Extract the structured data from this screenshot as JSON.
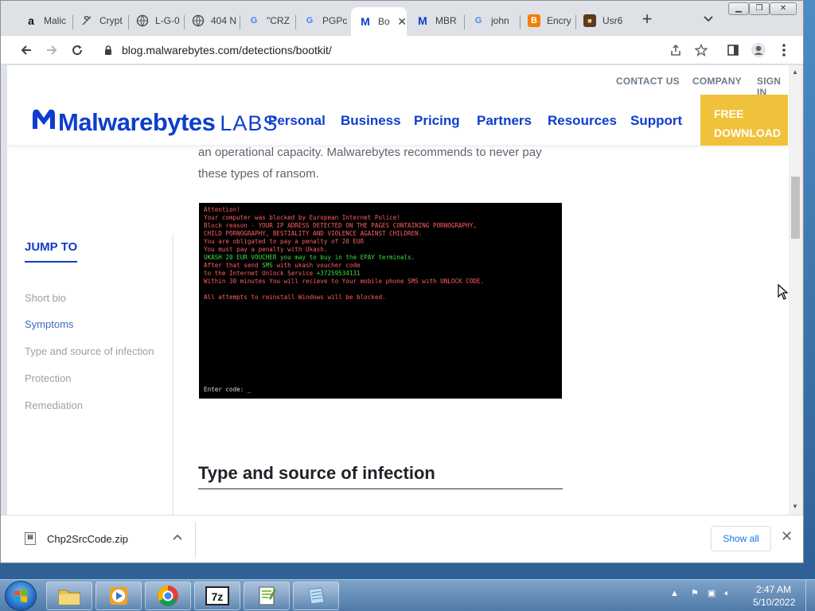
{
  "browser": {
    "tabs": [
      {
        "label": "Malic",
        "favicon": "amazon-icon"
      },
      {
        "label": "Crypt",
        "favicon": "crypto-icon"
      },
      {
        "label": "L-G-0",
        "favicon": "globe-icon"
      },
      {
        "label": "404 N",
        "favicon": "globe-icon"
      },
      {
        "label": "\"CRZ",
        "favicon": "google-icon"
      },
      {
        "label": "PGPc",
        "favicon": "google-icon"
      },
      {
        "label": "Bo",
        "favicon": "malwarebytes-icon",
        "active": true
      },
      {
        "label": "MBR",
        "favicon": "malwarebytes-icon"
      },
      {
        "label": "john",
        "favicon": "google-icon"
      },
      {
        "label": "Encry",
        "favicon": "blogger-icon"
      },
      {
        "label": "Usr6",
        "favicon": "site-icon"
      }
    ],
    "url": "blog.malwarebytes.com/detections/bootkit/"
  },
  "site": {
    "top_links": [
      "CONTACT US",
      "COMPANY",
      "SIGN IN"
    ],
    "logo_word": "Malwarebytes",
    "logo_labs": "LABS",
    "nav": [
      "Personal",
      "Business",
      "Pricing",
      "Partners",
      "Resources",
      "Support"
    ],
    "cta_line1": "FREE",
    "cta_line2": "DOWNLOAD",
    "brand_color": "#0d3ecc",
    "cta_color": "#f0c23b"
  },
  "article": {
    "intro_line1": "an operational capacity.  Malwarebytes recommends to never pay",
    "intro_line2": "these types of ransom.",
    "ransom_screen": {
      "lines": [
        "Attention!",
        "Your computer was blocked by European Internet Police!",
        "Block reason - YOUR IP ADRESS DETECTED ON THE PAGES CONTAINING PORNOGRAPHY,",
        "CHILD PORNOGRAPHY, BESTIALITY AND VIOLENCE AGAINST CHILDREN.",
        "You are obligated to pay a penalty of 20 EUR",
        "You must pay a penalty with Ukash.",
        "UKASH 20 EUR VOUCHER you may to buy in the EPAY terminals.",
        "After that send SMS with ukash voucher code",
        "to the Internet Unlock Service  +37259534131",
        "Within 30 minutes You will recieve to Your mobile phone SMS with UNLOCK CODE.",
        "",
        "All attempts to reinstall Windows will be blocked."
      ],
      "prompt": "Enter code: _"
    },
    "section_heading": "Type and source of infection"
  },
  "sidebar": {
    "heading": "JUMP TO",
    "items": [
      {
        "label": "Short bio"
      },
      {
        "label": "Symptoms",
        "active": true
      },
      {
        "label": "Type and source of infection"
      },
      {
        "label": "Protection"
      },
      {
        "label": "Remediation"
      }
    ]
  },
  "downloads": {
    "file": "Chp2SrcCode.zip",
    "show_all": "Show all"
  },
  "taskbar": {
    "apps": [
      "file-explorer-icon",
      "media-player-icon",
      "chrome-icon",
      "7zip-icon",
      "notepad-plus-icon",
      "notepad-icon"
    ],
    "time": "2:47 AM",
    "date": "5/10/2022"
  }
}
